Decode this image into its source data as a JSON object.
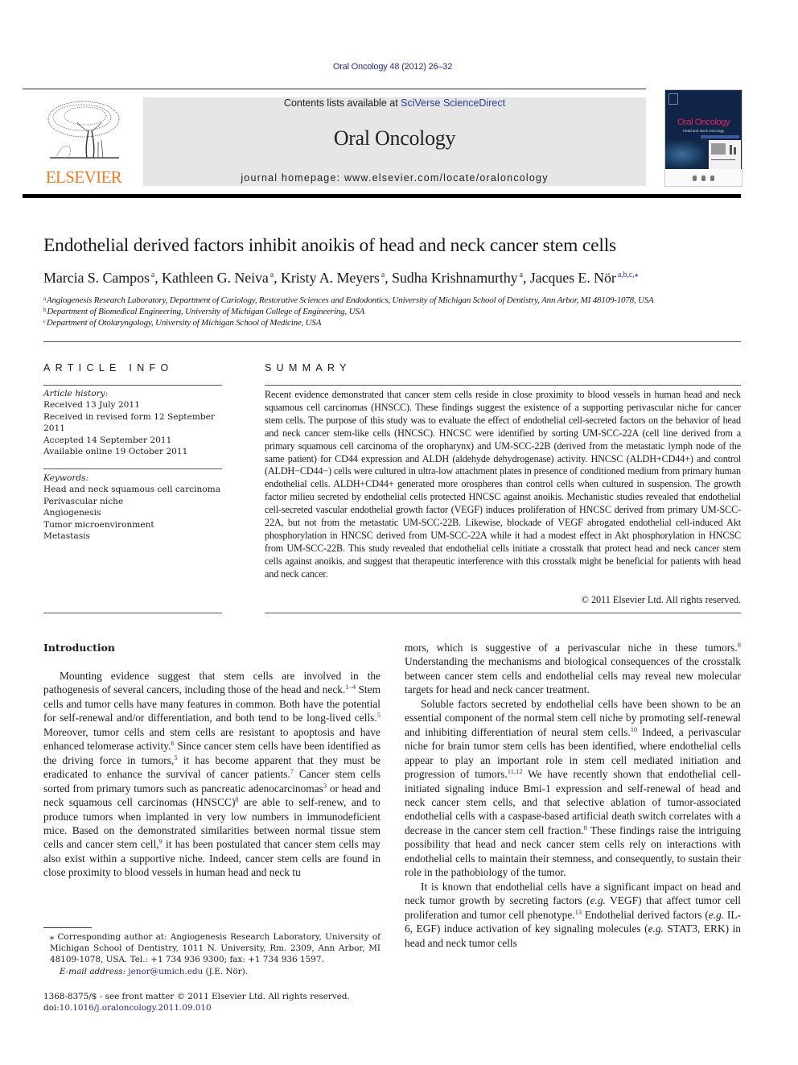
{
  "citation": "Oral Oncology 48 (2012) 26–32",
  "header": {
    "contents_prefix": "Contents lists available at ",
    "contents_link": "SciVerse ScienceDirect",
    "journal_name": "Oral Oncology",
    "homepage": "journal homepage: www.elsevier.com/locate/oraloncology",
    "publisher_logo_text": "ELSEVIER",
    "cover_title": "Oral Oncology",
    "cover_subtitle": "Head and Neck Oncology"
  },
  "colors": {
    "link": "#2a2a8a",
    "elsevier_orange": "#f47a20",
    "header_band": "#e6e6e6",
    "cover_bg": "#0f2447",
    "cover_title": "#e0245e"
  },
  "article": {
    "title": "Endothelial derived factors inhibit anoikis of head and neck cancer stem cells",
    "authors": [
      {
        "name": "Marcia S. Campos",
        "sup": "a"
      },
      {
        "name": "Kathleen G. Neiva",
        "sup": "a"
      },
      {
        "name": "Kristy A. Meyers",
        "sup": "a"
      },
      {
        "name": "Sudha Krishnamurthy",
        "sup": "a"
      },
      {
        "name": "Jacques E. Nör",
        "sup": "a,b,c,⁎"
      }
    ],
    "affiliations": [
      {
        "sup": "a",
        "text": "Angiogenesis Research Laboratory, Department of Cariology, Restorative Sciences and Endodontics, University of Michigan School of Dentistry, Ann Arbor, MI 48109-1078, USA"
      },
      {
        "sup": "b",
        "text": "Department of Biomedical Engineering, University of Michigan College of Engineering, USA"
      },
      {
        "sup": "c",
        "text": "Department of Otolaryngology, University of Michigan School of Medicine, USA"
      }
    ]
  },
  "article_info": {
    "heading": "ARTICLE INFO",
    "history_label": "Article history:",
    "history": [
      "Received 13 July 2011",
      "Received in revised form 12 September 2011",
      "Accepted 14 September 2011",
      "Available online 19 October 2011"
    ],
    "keywords_label": "Keywords:",
    "keywords": [
      "Head and neck squamous cell carcinoma",
      "Perivascular niche",
      "Angiogenesis",
      "Tumor microenvironment",
      "Metastasis"
    ]
  },
  "summary": {
    "heading": "SUMMARY",
    "text": "Recent evidence demonstrated that cancer stem cells reside in close proximity to blood vessels in human head and neck squamous cell carcinomas (HNSCC). These findings suggest the existence of a supporting per­ivascular niche for cancer stem cells. The purpose of this study was to evaluate the effect of endothelial cell-secreted factors on the behavior of head and neck cancer stem-like cells (HNCSC). HNCSC were identified by sorting UM-SCC-22A (cell line derived from a primary squamous cell carcinoma of the oropharynx) and UM-SCC-22B (derived from the metastatic lymph node of the same patient) for CD44 expression and ALDH (alde­hyde dehydrogenase) activity. HNCSC (ALDH+CD44+) and control (ALDH−CD44−) cells were cultured in ultra-low attachment plates in presence of conditioned medium from primary human endothelial cells. ALDH+CD44+ generated more orospheres than control cells when cultured in suspension. The growth factor milieu secreted by endothelial cells protected HNCSC against anoikis. Mechanistic studies revealed that endothelial cell-secreted vascular endothelial growth factor (VEGF) induces proliferation of HNCSC derived from primary UM-SCC-22A, but not from the metastatic UM-SCC-22B. Likewise, blockade of VEGF abrogated endothelial cell-induced Akt phosphorylation in HNCSC derived from UM-SCC-22A while it had a modest effect in Akt phosphorylation in HNCSC from UM-SCC-22B. This study revealed that endothelial cells initiate a crosstalk that protect head and neck cancer stem cells against anoikis, and suggest that therapeutic inter­ference with this crosstalk might be beneficial for patients with head and neck cancer.",
    "copyright": "© 2011 Elsevier Ltd. All rights reserved."
  },
  "introduction": {
    "heading": "Introduction",
    "left_paragraph": [
      {
        "t": "Mounting evidence suggest that stem cells are involved in the pathogenesis of several cancers, including those of the head and neck."
      },
      {
        "ref": "1–4"
      },
      {
        "t": " Stem cells and tumor cells have many features in common. Both have the potential for self-renewal and/or differentiation, and both tend to be long-lived cells."
      },
      {
        "ref": "5"
      },
      {
        "t": " Moreover, tumor cells and stem cells are resistant to apoptosis and have enhanced telomerase activity."
      },
      {
        "ref": "6"
      },
      {
        "t": " Since cancer stem cells have been identified as the driv­ing force in tumors,"
      },
      {
        "ref": "5"
      },
      {
        "t": " it has become apparent that they must be eradicated to enhance the survival of cancer patients."
      },
      {
        "ref": "7"
      },
      {
        "t": " Cancer stem cells sorted from primary tumors such as pancreatic adenocarcino­mas"
      },
      {
        "ref": "3"
      },
      {
        "t": " or head and neck squamous cell carcinomas (HNSCC)"
      },
      {
        "ref": "8"
      },
      {
        "t": " are able to self-renew, and to produce tumors when implanted in very low numbers in immunodeficient mice. Based on the demon­strated similarities between normal tissue stem cells and cancer stem cell,"
      },
      {
        "ref": "9"
      },
      {
        "t": " it has been postulated that cancer stem cells may also exist within a supportive niche. Indeed, cancer stem cells are found in close proximity to blood vessels in human head and neck tu­"
      }
    ],
    "right_paragraphs": [
      [
        {
          "t": "mors, which is suggestive of a perivascular niche in these tumors."
        },
        {
          "ref": "8"
        },
        {
          "t": " Understanding the mechanisms and biological consequences of the crosstalk between cancer stem cells and endothelial cells may re­veal new molecular targets for head and neck cancer treatment."
        }
      ],
      [
        {
          "t": "Soluble factors secreted by endothelial cells have been shown to be an essential component of the normal stem cell niche by pro­moting self-renewal and inhibiting differentiation of neural stem cells."
        },
        {
          "ref": "10"
        },
        {
          "t": " Indeed, a perivascular niche for brain tumor stem cells has been identified, where endothelial cells appear to play an important role in stem cell mediated initiation and progression of tumors."
        },
        {
          "ref": "11,12"
        },
        {
          "t": " We have recently shown that endothelial cell-initiated signaling induce Bmi-1 expression and self-renewal of head and neck cancer stem cells, and that selective ablation of tu­mor-associated endothelial cells with a caspase-based artificial death switch correlates with a decrease in the cancer stem cell fraction."
        },
        {
          "ref": "8"
        },
        {
          "t": " These findings raise the intriguing possibility that head and neck cancer stem cells rely on interactions with endothelial cells to maintain their stemness, and consequently, to sustain their role in the pathobiology of the tumor."
        }
      ],
      [
        {
          "t": "It is known that endothelial cells have a significant impact on head and neck tumor growth by secreting factors ("
        },
        {
          "i": "e.g."
        },
        {
          "t": " VEGF) that affect tumor cell proliferation and tumor cell phenotype."
        },
        {
          "ref": "13"
        },
        {
          "t": " Endo­thelial derived factors ("
        },
        {
          "i": "e.g."
        },
        {
          "t": " IL-6, EGF) induce activation of key sig­naling molecules ("
        },
        {
          "i": "e.g."
        },
        {
          "t": " STAT3, ERK) in head and neck tumor cells"
        }
      ]
    ]
  },
  "footnote": {
    "corresponding": "⁎ Corresponding author at: Angiogenesis Research Laboratory, University of Michigan School of Dentistry, 1011 N. University, Rm. 2309, Ann Arbor, MI 48109-1078, USA. Tel.: +1 734 936 9300; fax: +1 734 936 1597.",
    "email_label": "E-mail address:",
    "email": "jenor@umich.edu",
    "email_suffix": " (J.E. Nör).",
    "front_matter": "1368-8375/$ - see front matter © 2011 Elsevier Ltd. All rights reserved.",
    "doi_prefix": "doi:",
    "doi": "10.1016/j.oraloncology.2011.09.010"
  }
}
